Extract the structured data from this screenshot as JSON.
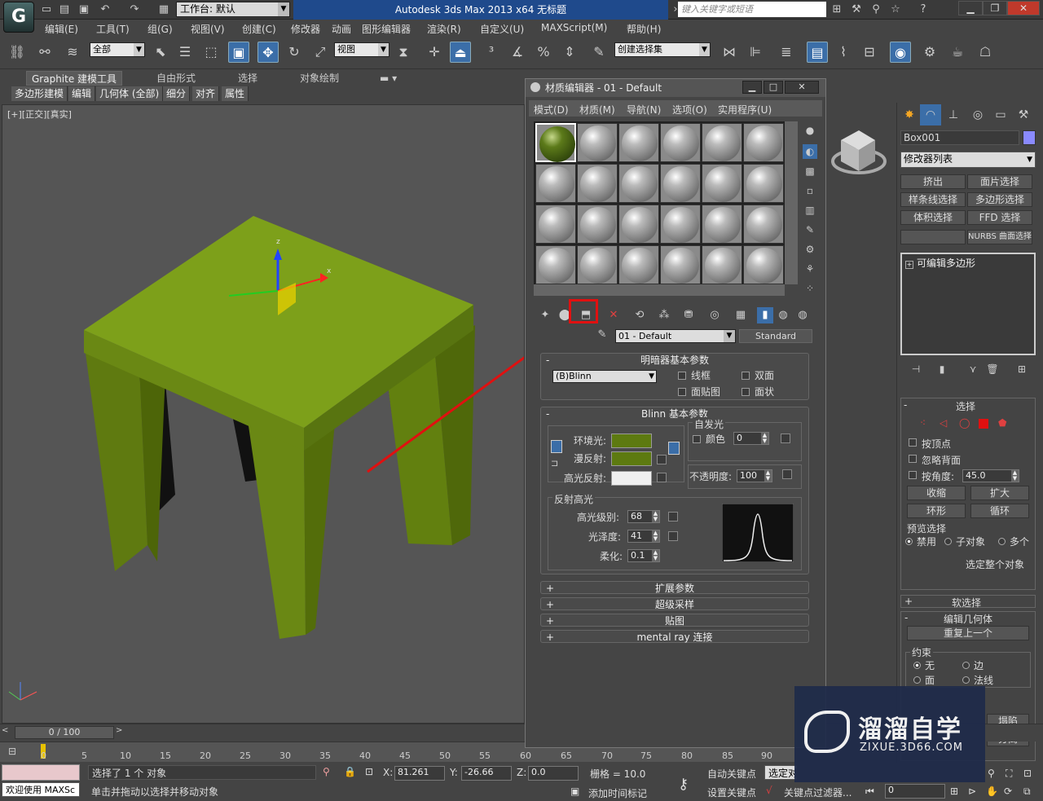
{
  "titlebar": {
    "workspace": "工作台: 默认",
    "app_title": "Autodesk 3ds Max  2013 x64       无标题",
    "search_placeholder": "键入关键字或短语"
  },
  "menus": [
    "编辑(E)",
    "工具(T)",
    "组(G)",
    "视图(V)",
    "创建(C)",
    "修改器",
    "动画",
    "图形编辑器",
    "渲染(R)",
    "自定义(U)",
    "MAXScript(M)",
    "帮助(H)"
  ],
  "toolbar": {
    "filter_select": "全部",
    "ref_coord": "视图",
    "named_selection": "创建选择集"
  },
  "ribbon": {
    "tabs": [
      "Graphite 建模工具",
      "自由形式",
      "选择",
      "对象绘制"
    ],
    "subtabs": [
      "多边形建模",
      "编辑",
      "几何体 (全部)",
      "细分",
      "对齐",
      "属性"
    ]
  },
  "viewport": {
    "label": "[+][正交][真实]",
    "gizmo_z": "z",
    "gizmo_x": "x"
  },
  "material_editor": {
    "title": "材质编辑器 - 01 - Default",
    "menus": [
      "模式(D)",
      "材质(M)",
      "导航(N)",
      "选项(O)",
      "实用程序(U)"
    ],
    "material_name": "01 - Default",
    "material_type": "Standard",
    "shader_rollout": {
      "title": "明暗器基本参数",
      "shader": "(B)Blinn",
      "wire": "线框",
      "two_sided": "双面",
      "face_map": "面贴图",
      "faceted": "面状"
    },
    "blinn_rollout": {
      "title": "Blinn 基本参数",
      "self_illum": "自发光",
      "color": "颜色",
      "color_value": "0",
      "ambient": "环境光:",
      "diffuse": "漫反射:",
      "specular": "高光反射:",
      "opacity": "不透明度:",
      "opacity_value": "100",
      "ambient_color": "#5d7a10",
      "diffuse_color": "#5d7a10",
      "specular_color": "#f0f0f0"
    },
    "highlights": {
      "title": "反射高光",
      "level_label": "高光级别:",
      "level": "68",
      "gloss_label": "光泽度:",
      "gloss": "41",
      "soften_label": "柔化:",
      "soften": "0.1"
    },
    "collapsed_rollouts": [
      "扩展参数",
      "超级采样",
      "贴图",
      "mental ray 连接"
    ]
  },
  "command_panel": {
    "object_name": "Box001",
    "modifier_list": "修改器列表",
    "modifier_buttons": [
      "挤出",
      "面片选择",
      "样条线选择",
      "多边形选择",
      "体积选择",
      "FFD 选择",
      "",
      "NURBS 曲面选择"
    ],
    "stack_item": "可编辑多边形",
    "selection_title": "选择",
    "by_vertex": "按顶点",
    "ignore_backface": "忽略背面",
    "by_angle": "按角度:",
    "angle_value": "45.0",
    "shrink": "收缩",
    "grow": "扩大",
    "ring": "环形",
    "loop": "循环",
    "preview": "预览选择",
    "disabled": "禁用",
    "sub_object": "子对象",
    "multi": "多个",
    "select_whole": "选定整个对象",
    "soft_selection": "软选择",
    "edit_geometry": "编辑几何体",
    "repeat_last": "重复上一个",
    "constraints": "约束",
    "c_none": "无",
    "c_edge": "边",
    "c_face": "面",
    "c_normal": "法线",
    "collapse": "塌陷",
    "detach": "分离"
  },
  "timeline": {
    "frame": "0 / 100",
    "ticks": [
      "0",
      "5",
      "10",
      "15",
      "20",
      "25",
      "30",
      "35",
      "40",
      "45",
      "50",
      "55",
      "60",
      "65",
      "70",
      "75",
      "80",
      "85",
      "90"
    ]
  },
  "status": {
    "welcome": "欢迎使用 MAXSc",
    "selected": "选择了 1 个 对象",
    "hint": "单击并拖动以选择并移动对象",
    "x_label": "X:",
    "x": "81.261",
    "y_label": "Y:",
    "y": "-26.66",
    "z_label": "Z:",
    "z": "0.0",
    "grid": "栅格 = 10.0",
    "add_time_tag": "添加时间标记",
    "auto_key": "自动关键点",
    "set_key": "设置关键点",
    "selected_obj": "选定对象",
    "key_filters": "关键点过滤器...",
    "frame_field": "0"
  },
  "watermark": {
    "title": "溜溜自学",
    "site": "ZIXUE.3D66.COM"
  }
}
